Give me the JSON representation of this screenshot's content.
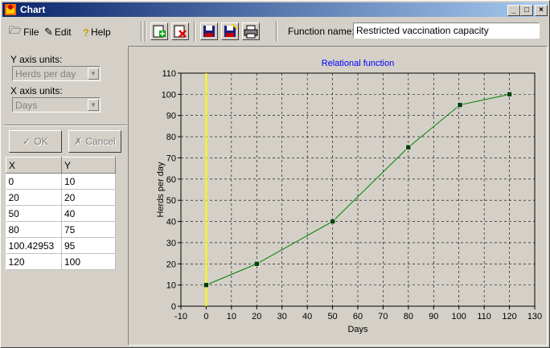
{
  "window": {
    "title": "Chart",
    "minimize": "_",
    "maximize": "□",
    "close": "×"
  },
  "menu": {
    "file": "File",
    "edit": "Edit",
    "help": "Help"
  },
  "toolbar": {
    "function_name_label": "Function name:",
    "function_name_value": "Restricted vaccination capacity"
  },
  "left": {
    "y_units_label": "Y axis units:",
    "y_units_value": "Herds per day",
    "x_units_label": "X axis units:",
    "x_units_value": "Days",
    "ok_label": "OK",
    "cancel_label": "Cancel"
  },
  "table": {
    "headers": [
      "X",
      "Y"
    ],
    "rows": [
      [
        "0",
        "10"
      ],
      [
        "20",
        "20"
      ],
      [
        "50",
        "40"
      ],
      [
        "80",
        "75"
      ],
      [
        "100.42953",
        "95"
      ],
      [
        "120",
        "100"
      ]
    ]
  },
  "chart_data": {
    "type": "line",
    "title": "Relational function",
    "xlabel": "Days",
    "ylabel": "Herds per day",
    "xlim": [
      -10,
      130
    ],
    "ylim": [
      0,
      110
    ],
    "xticks": [
      -10,
      0,
      10,
      20,
      30,
      40,
      50,
      60,
      70,
      80,
      90,
      100,
      110,
      120,
      130
    ],
    "yticks": [
      0,
      10,
      20,
      30,
      40,
      50,
      60,
      70,
      80,
      90,
      100,
      110
    ],
    "grid": true,
    "points": [
      [
        0,
        10
      ],
      [
        20,
        20
      ],
      [
        50,
        40
      ],
      [
        80,
        75
      ],
      [
        100.42953,
        95
      ],
      [
        120,
        100
      ]
    ],
    "vline_x": 0,
    "colors": {
      "line": "#008000",
      "marker": "#004000",
      "vline": "#ffff00",
      "title": "#0000ff",
      "background": "#d4d0c8"
    }
  }
}
